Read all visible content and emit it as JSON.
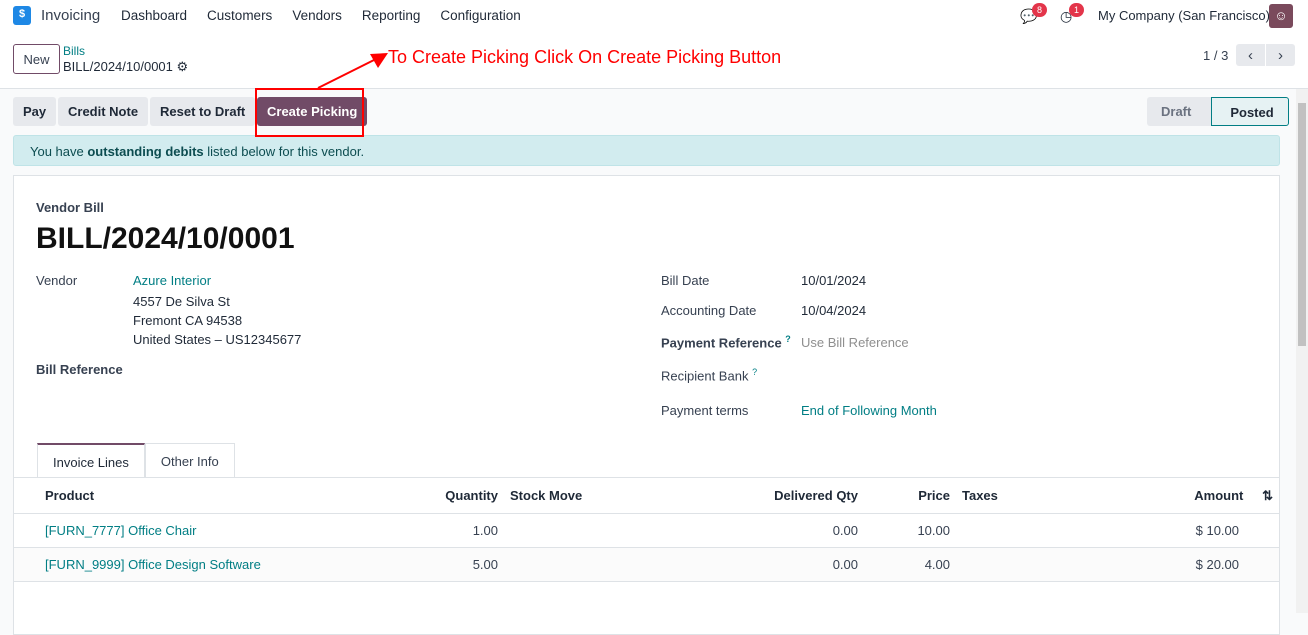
{
  "nav": {
    "app_name": "Invoicing",
    "menu": [
      "Dashboard",
      "Customers",
      "Vendors",
      "Reporting",
      "Configuration"
    ],
    "messages_count": "8",
    "activities_count": "1",
    "company": "My Company (San Francisco)"
  },
  "control": {
    "new_label": "New",
    "breadcrumb_parent": "Bills",
    "breadcrumb_current": "BILL/2024/10/0001",
    "pager": "1 / 3"
  },
  "actions": {
    "pay": "Pay",
    "credit_note": "Credit Note",
    "reset": "Reset to Draft",
    "create_picking": "Create Picking"
  },
  "status": {
    "draft": "Draft",
    "posted": "Posted",
    "current": "Posted"
  },
  "alert": {
    "pre": "You have ",
    "bold": "outstanding debits",
    "post": " listed below for this vendor."
  },
  "form": {
    "type": "Vendor Bill",
    "name": "BILL/2024/10/0001",
    "vendor_label": "Vendor",
    "vendor": "Azure Interior",
    "address": [
      "4557 De Silva St",
      "Fremont CA 94538",
      "United States – US12345677"
    ],
    "bill_ref_label": "Bill Reference",
    "bill_date_label": "Bill Date",
    "bill_date": "10/01/2024",
    "acc_date_label": "Accounting Date",
    "acc_date": "10/04/2024",
    "pay_ref_label": "Payment Reference",
    "pay_ref_placeholder": "Use Bill Reference",
    "bank_label": "Recipient Bank",
    "terms_label": "Payment terms",
    "terms": "End of Following Month",
    "help_mark": "?"
  },
  "tabs": [
    "Invoice Lines",
    "Other Info"
  ],
  "lines": {
    "headers": [
      "Product",
      "Quantity",
      "Stock Move",
      "Delivered Qty",
      "Price",
      "Taxes",
      "Amount"
    ],
    "rows": [
      {
        "product": "[FURN_7777] Office Chair",
        "qty": "1.00",
        "stock_move": "",
        "delivered": "0.00",
        "price": "10.00",
        "taxes": "",
        "amount": "$ 10.00"
      },
      {
        "product": "[FURN_9999] Office Design Software",
        "qty": "5.00",
        "stock_move": "",
        "delivered": "0.00",
        "price": "4.00",
        "taxes": "",
        "amount": "$ 20.00"
      }
    ]
  },
  "annotation": {
    "text": "To Create Picking Click On Create Picking Button",
    "color": "#ff0000"
  },
  "colors": {
    "primary": "#714b67",
    "link": "#017e84"
  }
}
